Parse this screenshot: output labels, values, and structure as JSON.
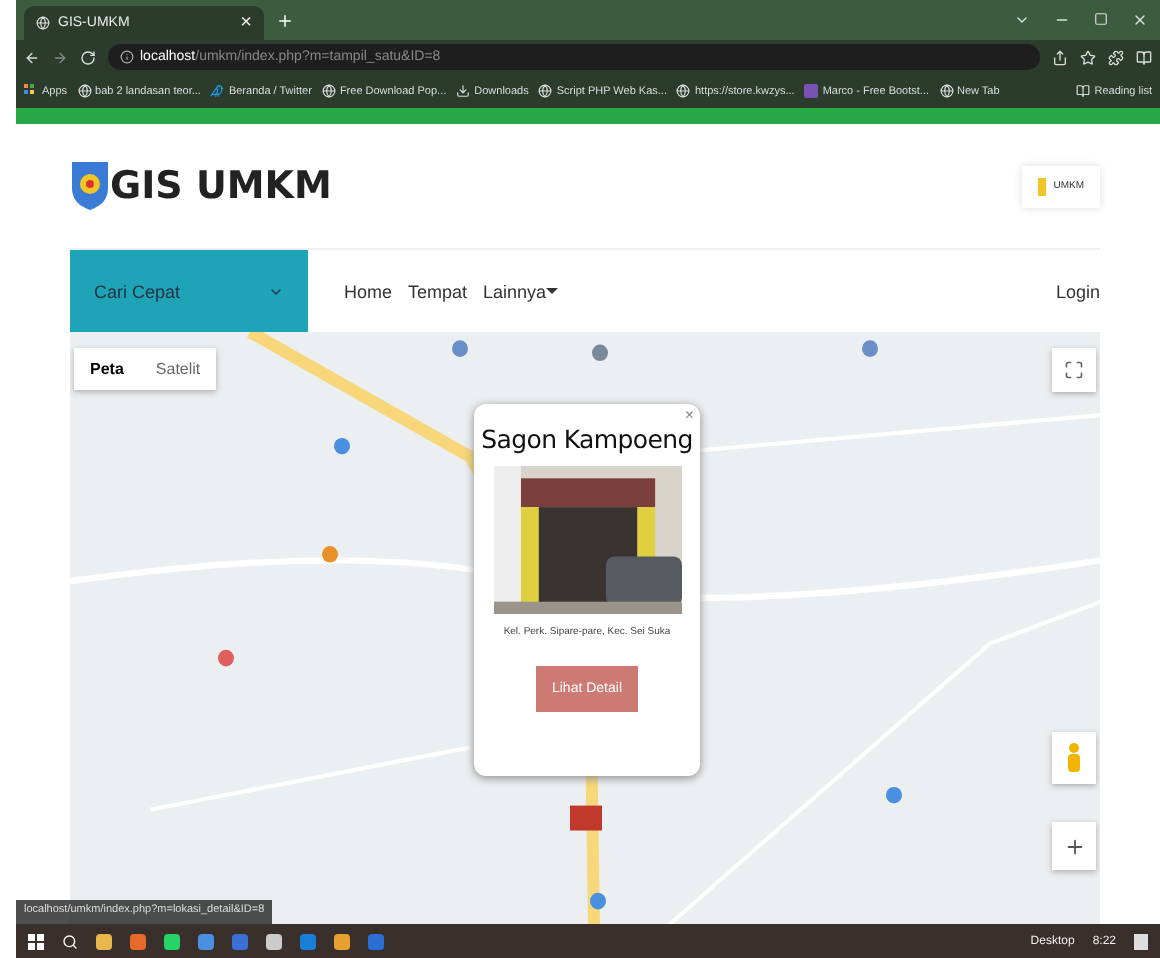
{
  "browser": {
    "tab": {
      "title": "GIS-UMKM",
      "close": "×"
    },
    "address": {
      "host": "localhost",
      "path": "/umkm/index.php?m=tampil_satu&ID=8"
    },
    "bookmarks": [
      {
        "label": "Apps",
        "kind": "apps"
      },
      {
        "label": "bab 2 landasan teor...",
        "kind": "globe"
      },
      {
        "label": "Beranda / Twitter",
        "kind": "bird"
      },
      {
        "label": "Free Download Pop...",
        "kind": "globe"
      },
      {
        "label": "Downloads",
        "kind": "download"
      },
      {
        "label": "Script PHP Web Kas...",
        "kind": "globe"
      },
      {
        "label": "https://store.kwzys...",
        "kind": "globe"
      },
      {
        "label": "Marco - Free Bootst...",
        "kind": "purple"
      },
      {
        "label": "New Tab",
        "kind": "globe"
      }
    ],
    "reading_list": "Reading list"
  },
  "header": {
    "logo": "GIS UMKM",
    "badge": "UMKM"
  },
  "nav": {
    "dropdown": "Cari Cepat",
    "links": [
      {
        "label": "Home",
        "dropdown": false
      },
      {
        "label": "Tempat",
        "dropdown": false
      },
      {
        "label": "Lainnya",
        "dropdown": true
      }
    ],
    "login": "Login"
  },
  "map": {
    "kind": "picture",
    "types": [
      {
        "label": "Peta",
        "selected": true
      },
      {
        "label": "Satelit",
        "selected": false
      }
    ],
    "popup": {
      "title": "Sagon Kampoeng",
      "close": "×",
      "address": "Kel. Perk. Sipare-pare, Kec. Sei Suka",
      "button": "Lihat Detail"
    }
  },
  "status_url": "localhost/umkm/index.php?m=lokasi_detail&ID=8",
  "taskbar": {
    "desktop": "Desktop",
    "time": "8:22"
  }
}
